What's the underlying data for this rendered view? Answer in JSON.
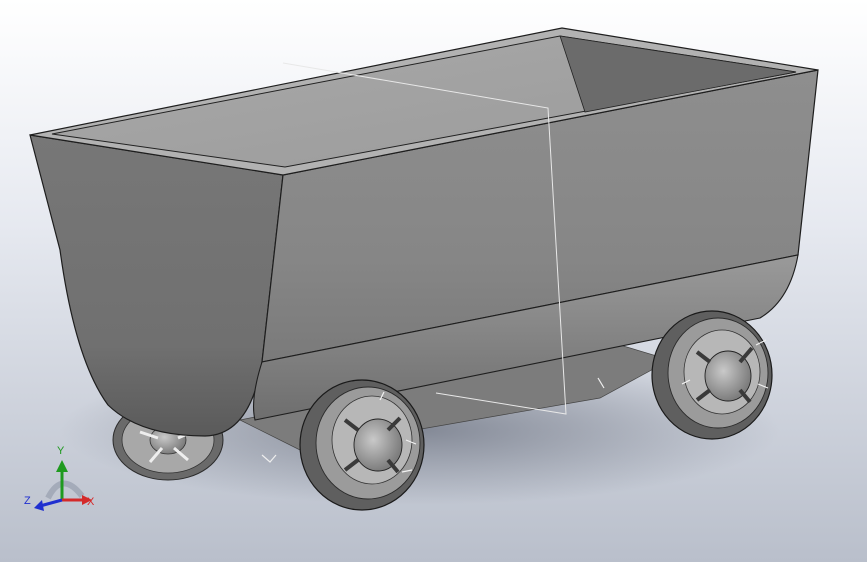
{
  "triad": {
    "x_label": "X",
    "y_label": "Y",
    "z_label": "Z",
    "x_color": "#d42a2a",
    "y_color": "#1f9a1f",
    "z_color": "#1f2fd0"
  },
  "model": {
    "body_color": "#8a8a8a",
    "icon": "mine-cart-model"
  }
}
